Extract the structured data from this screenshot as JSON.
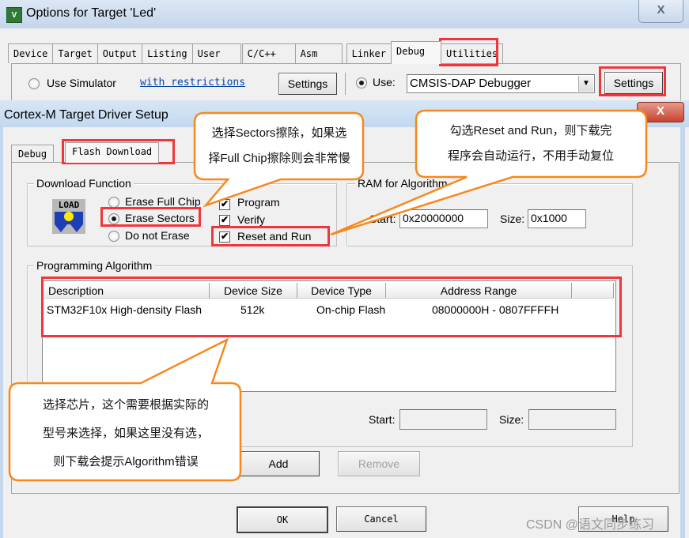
{
  "outer_window": {
    "title": "Options for Target 'Led'",
    "app_icon": "keil-uvision-icon",
    "close_label": "X",
    "tabs": [
      {
        "label": "Device",
        "active": false
      },
      {
        "label": "Target",
        "active": false
      },
      {
        "label": "Output",
        "active": false
      },
      {
        "label": "Listing",
        "active": false
      },
      {
        "label": "User",
        "active": false
      },
      {
        "label": "C/C++",
        "active": false
      },
      {
        "label": "Asm",
        "active": false
      },
      {
        "label": "Linker",
        "active": false
      },
      {
        "label": "Debug",
        "active": true
      },
      {
        "label": "Utilities",
        "active": false
      }
    ],
    "debug_panel": {
      "use_simulator_label": "Use Simulator",
      "use_simulator_selected": false,
      "with_restrictions_link": "with restrictions",
      "sim_settings_label": "Settings",
      "use_label": "Use:",
      "use_selected": true,
      "debugger_value": "CMSIS-DAP Debugger",
      "debugger_settings_label": "Settings"
    }
  },
  "inner_dialog": {
    "title": "Cortex-M Target Driver Setup",
    "close_label": "X",
    "tabs": [
      {
        "label": "Debug",
        "active": false
      },
      {
        "label": "Flash Download",
        "active": true
      }
    ],
    "download_function": {
      "group_label": "Download Function",
      "icon_text": "LOAD",
      "erase_options": [
        {
          "label": "Erase Full Chip",
          "selected": false
        },
        {
          "label": "Erase Sectors",
          "selected": true
        },
        {
          "label": "Do not Erase",
          "selected": false
        }
      ],
      "checks": [
        {
          "label": "Program",
          "checked": true
        },
        {
          "label": "Verify",
          "checked": true
        },
        {
          "label": "Reset and Run",
          "checked": true
        }
      ]
    },
    "ram_for_algorithm": {
      "group_label": "RAM for Algorithm",
      "start_label": "Start:",
      "start_value": "0x20000000",
      "size_label": "Size:",
      "size_value": "0x1000"
    },
    "programming_algorithm": {
      "group_label": "Programming Algorithm",
      "columns": [
        "Description",
        "Device Size",
        "Device Type",
        "Address Range"
      ],
      "rows": [
        {
          "description": "STM32F10x High-density Flash",
          "device_size": "512k",
          "device_type": "On-chip Flash",
          "address_range": "08000000H - 0807FFFFH"
        }
      ],
      "start_label": "Start:",
      "start_value": "",
      "size_label": "Size:",
      "size_value": "",
      "add_label": "Add",
      "remove_label": "Remove"
    },
    "buttons": {
      "ok": "OK",
      "cancel": "Cancel",
      "help": "Help"
    }
  },
  "annotations": {
    "callout_erase": [
      "选择Sectors擦除，如果选",
      "择Full Chip擦除则会非常慢"
    ],
    "callout_reset": [
      "勾选Reset and Run，则下载完",
      "程序会自动运行，不用手动复位"
    ],
    "callout_algorithm": [
      "选择芯片，这个需要根据实际的",
      "型号来选择，如果这里没有选，",
      "则下载会提示Algorithm错误"
    ],
    "highlight_color": "#f0363d",
    "callout_border_color": "#f5891f"
  },
  "watermark": "CSDN @语文同步练习"
}
